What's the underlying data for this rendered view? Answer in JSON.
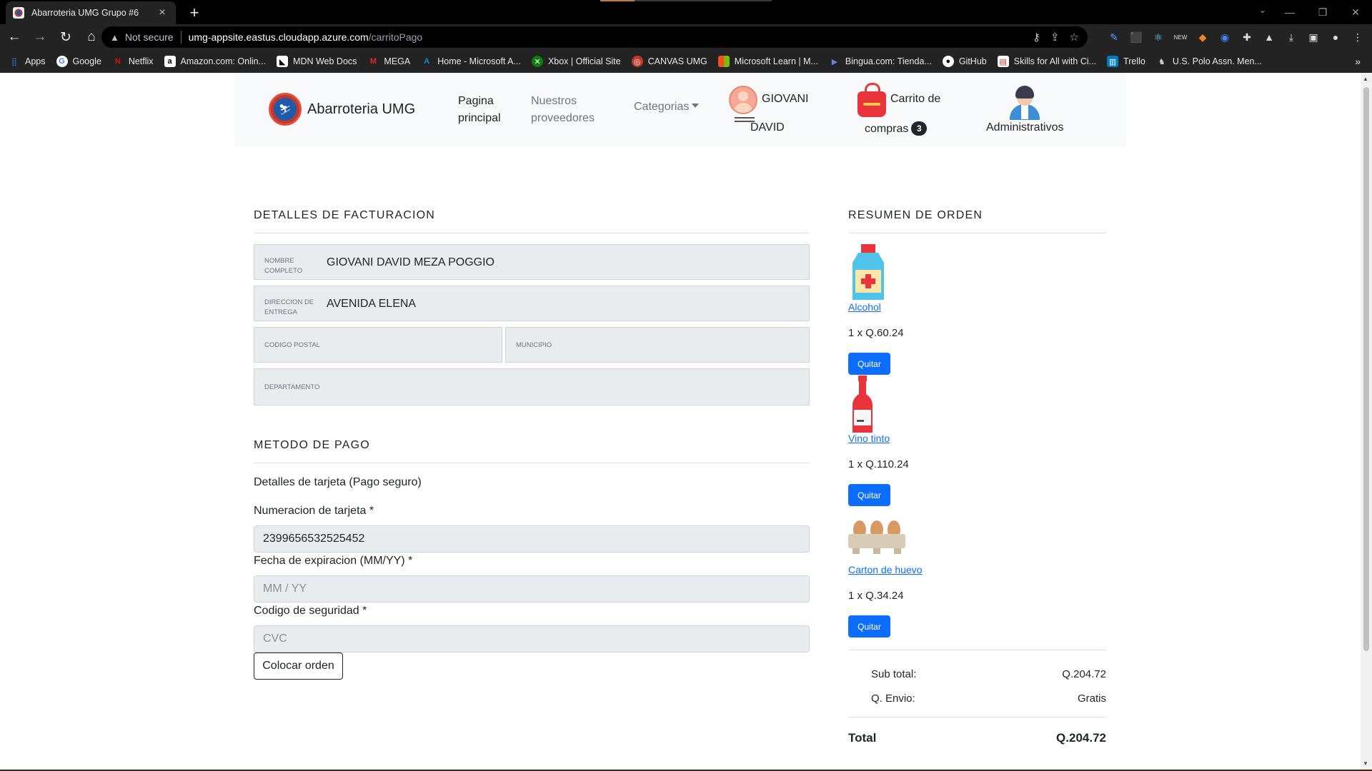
{
  "browser": {
    "tab_title": "Abarroteria UMG Grupo #6",
    "url_warning": "Not secure",
    "url_host": "umg-appsite.eastus.cloudapp.azure.com",
    "url_path": "/carritoPago",
    "bookmarks": [
      "Apps",
      "Google",
      "Netflix",
      "Amazon.com: Onlin...",
      "MDN Web Docs",
      "MEGA",
      "Home - Microsoft A...",
      "Xbox | Official Site",
      "CANVAS UMG",
      "Microsoft Learn | M...",
      "Bingua.com: Tienda...",
      "GitHub",
      "Skills for All with Ci...",
      "Trello",
      "U.S. Polo Assn. Men..."
    ]
  },
  "navbar": {
    "brand": "Abarroteria UMG",
    "home_line1": "Pagina",
    "home_line2": "principal",
    "providers_line1": "Nuestros",
    "providers_line2": "proveedores",
    "categories": "Categorias",
    "user_first": "GIOVANI",
    "user_last": "DAVID",
    "cart_line1": "Carrito de",
    "cart_line2": "compras",
    "cart_count": "3",
    "admin": "Administrativos"
  },
  "billing": {
    "title": "DETALLES DE FACTURACION",
    "name_label_1": "NOMBRE",
    "name_label_2": "COMPLETO",
    "name_value": "GIOVANI DAVID MEZA POGGIO",
    "address_label_1": "DIRECCION DE",
    "address_label_2": "ENTREGA",
    "address_value": "AVENIDA ELENA",
    "postal_label": "CODIGO POSTAL",
    "municipio_label": "MUNICIPIO",
    "departamento_label": "DEPARTAMENTO"
  },
  "payment": {
    "title": "METODO DE PAGO",
    "subtitle": "Detalles de tarjeta (Pago seguro)",
    "card_label": "Numeracion de tarjeta *",
    "card_value": "2399656532525452",
    "exp_label": "Fecha de expiracion (MM/YY) *",
    "exp_placeholder": "MM / YY",
    "cvc_label": "Codigo de seguridad *",
    "cvc_placeholder": "CVC",
    "submit": "Colocar orden"
  },
  "summary": {
    "title": "RESUMEN DE ORDEN",
    "items": [
      {
        "name": "Alcohol",
        "qty": "1 x Q.60.24",
        "remove": "Quitar",
        "icon": "alcohol-bottle-icon"
      },
      {
        "name": "Vino tinto",
        "qty": "1 x Q.110.24",
        "remove": "Quitar",
        "icon": "wine-bottle-icon"
      },
      {
        "name": "Carton de huevo",
        "qty": "1 x Q.34.24",
        "remove": "Quitar",
        "icon": "egg-carton-icon"
      }
    ],
    "subtotal_label": "Sub total:",
    "subtotal_value": "Q.204.72",
    "shipping_label": "Q. Envio:",
    "shipping_value": "Gratis",
    "total_label": "Total",
    "total_value": "Q.204.72"
  },
  "colors": {
    "primary": "#0d6efd",
    "navbar_bg": "#f8f9fa",
    "field_bg": "#e9ecef",
    "cart_red": "#e8343a"
  }
}
